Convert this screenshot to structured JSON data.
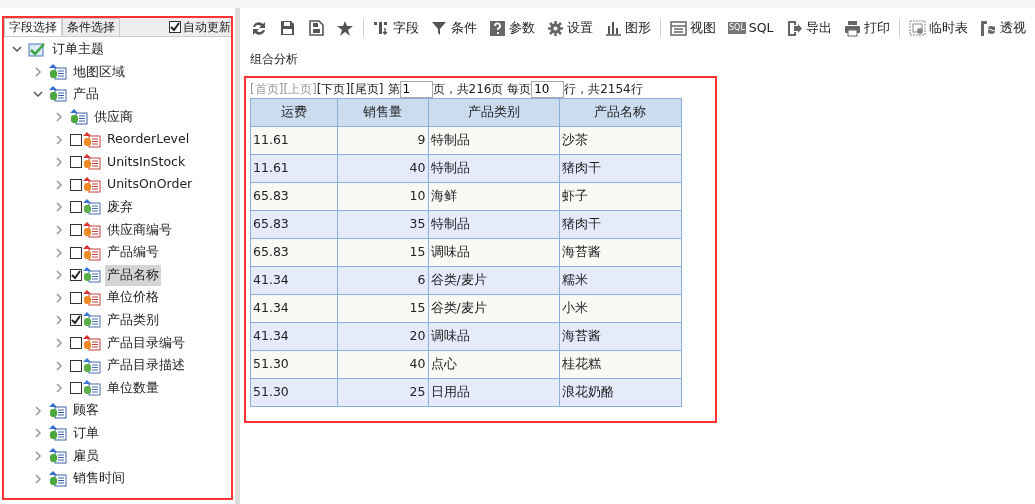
{
  "panel_tabs": [
    {
      "label": "字段选择",
      "selected": true
    },
    {
      "label": "条件选择",
      "selected": false
    }
  ],
  "auto_update": {
    "label": "自动更新",
    "checked": true
  },
  "tree": [
    {
      "label": "订单主题",
      "kind": "root",
      "expanded": true,
      "children": [
        {
          "label": "地图区域",
          "kind": "group",
          "expanded": false
        },
        {
          "label": "产品",
          "kind": "group",
          "expanded": true,
          "children": [
            {
              "label": "供应商",
              "kind": "group",
              "expanded": false
            },
            {
              "label": "ReorderLevel",
              "kind": "measure",
              "expanded": false,
              "checked": false,
              "selected": false
            },
            {
              "label": "UnitsInStock",
              "kind": "measure",
              "expanded": false,
              "checked": false,
              "selected": false
            },
            {
              "label": "UnitsOnOrder",
              "kind": "measure",
              "expanded": false,
              "checked": false,
              "selected": false
            },
            {
              "label": "废弃",
              "kind": "dimension",
              "expanded": false,
              "checked": false,
              "selected": false
            },
            {
              "label": "供应商编号",
              "kind": "measure",
              "expanded": false,
              "checked": false,
              "selected": false
            },
            {
              "label": "产品编号",
              "kind": "measure",
              "expanded": false,
              "checked": false,
              "selected": false
            },
            {
              "label": "产品名称",
              "kind": "dimension",
              "expanded": false,
              "checked": true,
              "selected": true
            },
            {
              "label": "单位价格",
              "kind": "measure",
              "expanded": false,
              "checked": false,
              "selected": false
            },
            {
              "label": "产品类别",
              "kind": "dimension",
              "expanded": false,
              "checked": true,
              "selected": false
            },
            {
              "label": "产品目录编号",
              "kind": "measure",
              "expanded": false,
              "checked": false,
              "selected": false
            },
            {
              "label": "产品目录描述",
              "kind": "dimension",
              "expanded": false,
              "checked": false,
              "selected": false
            },
            {
              "label": "单位数量",
              "kind": "dimension",
              "expanded": false,
              "checked": false,
              "selected": false
            }
          ]
        },
        {
          "label": "顾客",
          "kind": "group",
          "expanded": false
        },
        {
          "label": "订单",
          "kind": "group",
          "expanded": false
        },
        {
          "label": "雇员",
          "kind": "group",
          "expanded": false
        },
        {
          "label": "销售时间",
          "kind": "group",
          "expanded": false
        }
      ]
    }
  ],
  "toolbar": [
    {
      "kind": "button"
    },
    {
      "kind": "button"
    },
    {
      "kind": "button"
    },
    {
      "kind": "button"
    },
    {
      "kind": "separator"
    },
    {
      "kind": "button",
      "label": "字段"
    },
    {
      "kind": "button",
      "label": "条件"
    },
    {
      "kind": "button",
      "label": "参数"
    },
    {
      "kind": "button",
      "label": "设置"
    },
    {
      "kind": "button",
      "label": "图形"
    },
    {
      "kind": "separator"
    },
    {
      "kind": "button",
      "label": "视图"
    },
    {
      "kind": "button",
      "icon_text": "SQL",
      "label": "SQL"
    },
    {
      "kind": "button",
      "label": "导出"
    },
    {
      "kind": "button",
      "label": "打印"
    },
    {
      "kind": "separator"
    },
    {
      "kind": "button",
      "label": "临时表"
    },
    {
      "kind": "button",
      "label": "透视"
    }
  ],
  "report_title": "组合分析",
  "pager": {
    "links": [
      {
        "label": "[首页]",
        "disabled": true
      },
      {
        "label": "[上页]",
        "disabled": true
      },
      {
        "label": "[下页]",
        "disabled": false
      },
      {
        "label": "[尾页]",
        "disabled": false
      }
    ],
    "page_prefix": "第",
    "page_value": "1",
    "page_suffix": "页，共216页 每页",
    "rows_value": "10",
    "rows_suffix": "行，共2154行"
  },
  "table": {
    "columns": [
      {
        "label": "运费"
      },
      {
        "label": "销售量"
      },
      {
        "label": "产品类别"
      },
      {
        "label": "产品名称"
      }
    ],
    "rows": [
      [
        "11.61",
        "9",
        "特制品",
        "沙茶"
      ],
      [
        "11.61",
        "40",
        "特制品",
        "猪肉干"
      ],
      [
        "65.83",
        "10",
        "海鲜",
        "虾子"
      ],
      [
        "65.83",
        "35",
        "特制品",
        "猪肉干"
      ],
      [
        "65.83",
        "15",
        "调味品",
        "海苔酱"
      ],
      [
        "41.34",
        "6",
        "谷类/麦片",
        "糯米"
      ],
      [
        "41.34",
        "15",
        "谷类/麦片",
        "小米"
      ],
      [
        "41.34",
        "20",
        "调味品",
        "海苔酱"
      ],
      [
        "51.30",
        "40",
        "点心",
        "桂花糕"
      ],
      [
        "51.30",
        "25",
        "日用品",
        "浪花奶酪"
      ]
    ]
  }
}
